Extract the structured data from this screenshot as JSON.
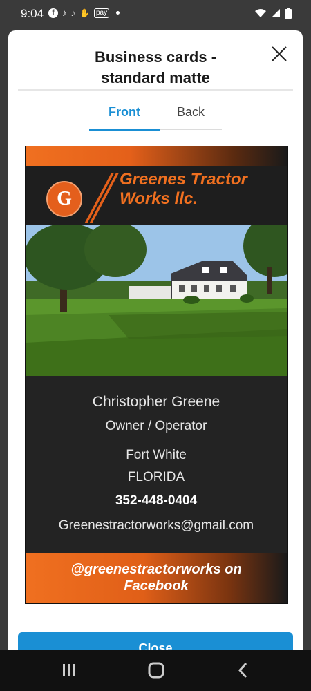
{
  "status_bar": {
    "time": "9:04",
    "notification_icons": [
      "facebook-icon",
      "tiktok-icon",
      "tiktok-icon",
      "samsung-pay-icon"
    ],
    "pay_label": "pay"
  },
  "modal": {
    "title": "Business cards -\nstandard matte",
    "tabs": [
      {
        "label": "Front",
        "selected": true
      },
      {
        "label": "Back",
        "selected": false
      }
    ],
    "close_button_label": "Close",
    "accent_color": "#1a8fd4"
  },
  "card": {
    "logo_letter": "G",
    "company_name": "Greenes Tractor\nWorks llc.",
    "owner_name": "Christopher Greene",
    "owner_title": "Owner / Operator",
    "city": "Fort White",
    "state": "FLORIDA",
    "phone": "352-448-0404",
    "email": "Greenestractorworks@gmail.com",
    "social": "@greenestractorworks on\nFacebook",
    "brand_color": "#f07020"
  }
}
